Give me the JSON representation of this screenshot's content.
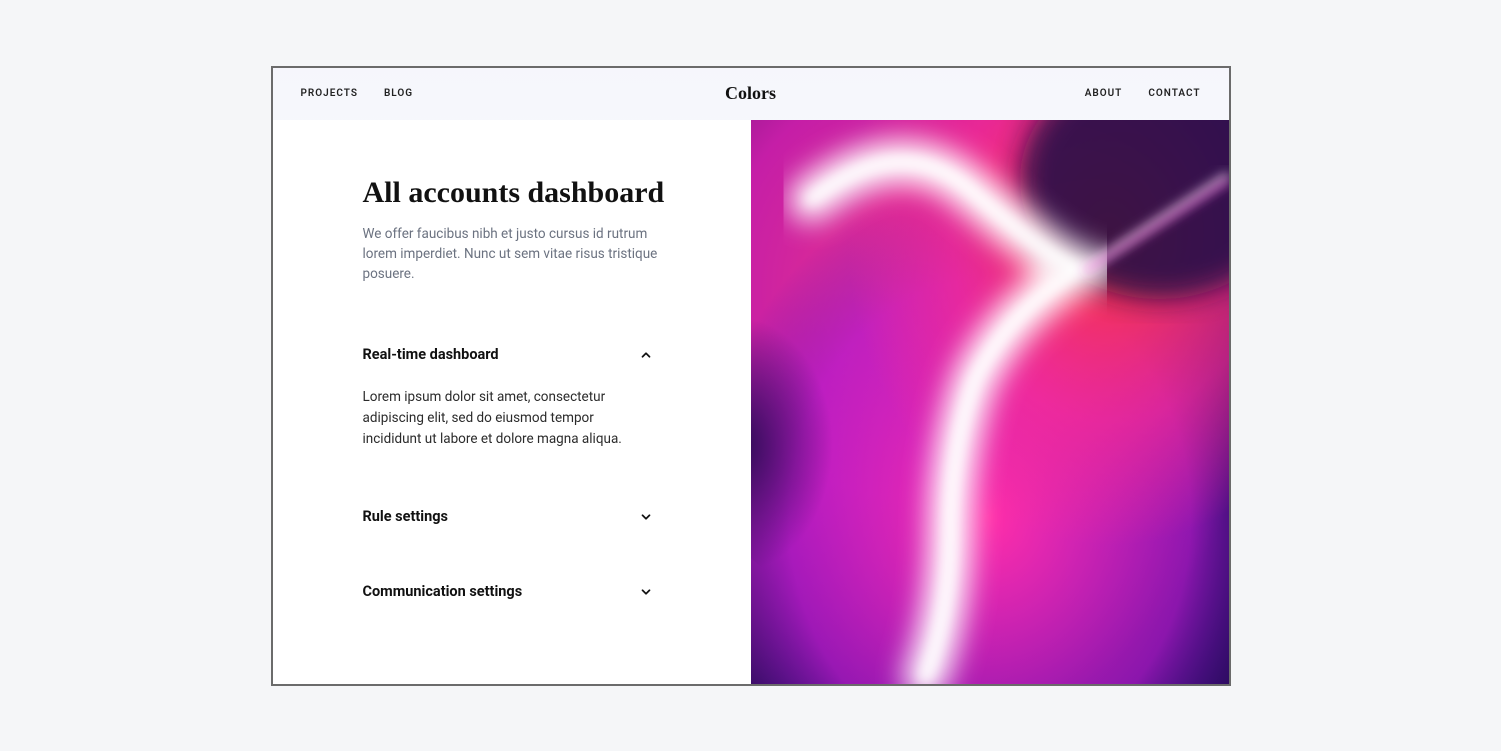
{
  "nav": {
    "left": [
      "PROJECTS",
      "BLOG"
    ],
    "right": [
      "ABOUT",
      "CONTACT"
    ]
  },
  "logo": "Colors",
  "main": {
    "title": "All accounts dashboard",
    "description": "We offer faucibus nibh et justo cursus id rutrum lorem imperdiet. Nunc ut sem vitae risus tristique posuere."
  },
  "accordion": [
    {
      "title": "Real-time dashboard",
      "expanded": true,
      "body": "Lorem ipsum dolor sit amet, consectetur adipiscing elit, sed do eiusmod tempor incididunt ut labore et dolore magna aliqua."
    },
    {
      "title": "Rule settings",
      "expanded": false
    },
    {
      "title": "Communication settings",
      "expanded": false
    }
  ]
}
